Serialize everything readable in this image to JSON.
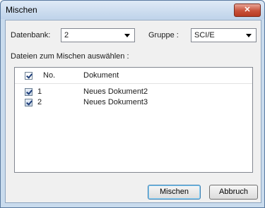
{
  "window": {
    "title": "Mischen",
    "close_label": "✕"
  },
  "form": {
    "database_label": "Datenbank:",
    "database_value": "2",
    "group_label": "Gruppe :",
    "group_value": "SCI/E",
    "instruction": "Dateien zum Mischen auswählen :"
  },
  "list": {
    "columns": {
      "no": "No.",
      "document": "Dokument"
    },
    "header_checked": true,
    "rows": [
      {
        "no": "1",
        "document": "Neues Dokument2",
        "checked": true
      },
      {
        "no": "2",
        "document": "Neues Dokument3",
        "checked": true
      }
    ]
  },
  "buttons": {
    "merge": "Mischen",
    "cancel": "Abbruch"
  }
}
